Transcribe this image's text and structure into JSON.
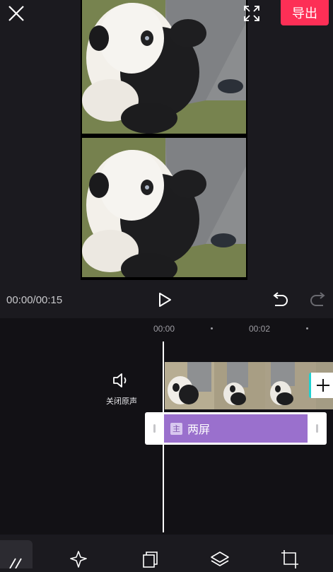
{
  "header": {
    "export_label": "导出"
  },
  "player": {
    "timecode": "00:00/00:15"
  },
  "timeline": {
    "ruler": [
      "00:00",
      "00:02"
    ],
    "mute_label": "关闭原声",
    "text_clip": {
      "badge": "主",
      "name": "两屏"
    }
  },
  "colors": {
    "export_button": "#fd2f56",
    "text_clip": "#9a70cd",
    "add_clip_accent": "#1fd1d1",
    "background": "#1b1a1f"
  },
  "icons": [
    "close-icon",
    "fullscreen-icon",
    "play-icon",
    "undo-icon",
    "redo-icon",
    "speaker-icon",
    "plus-icon",
    "double-chevron-left-icon",
    "sparkle-icon",
    "copy-icon",
    "layers-icon",
    "crop-icon"
  ]
}
